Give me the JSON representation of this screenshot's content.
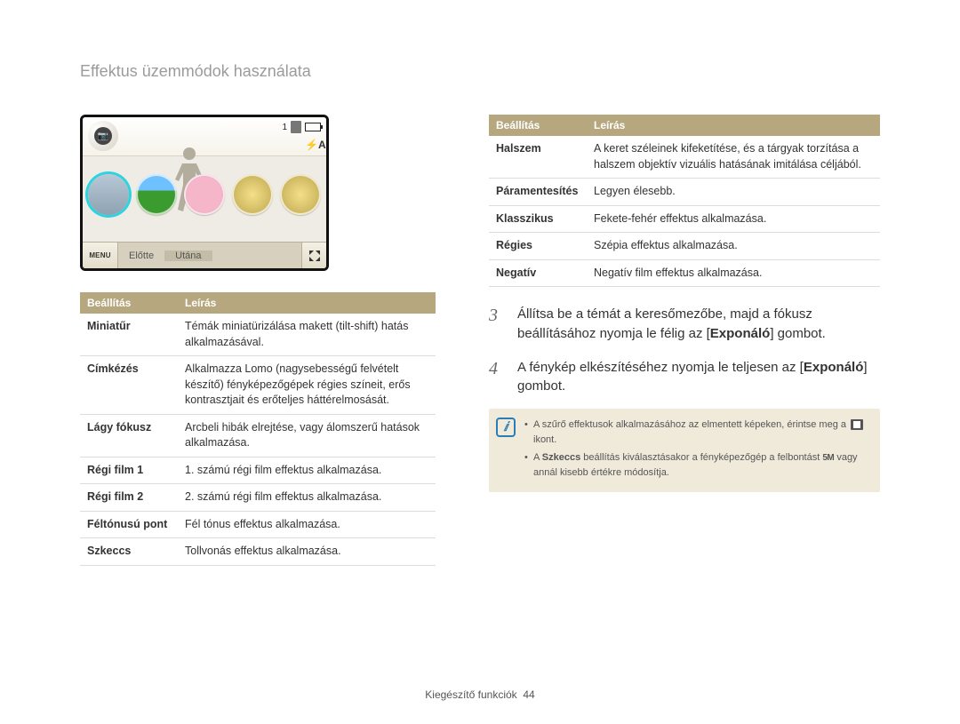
{
  "page_title": "Effektus üzemmódok használata",
  "lcd": {
    "status_number": "1",
    "flash": "⚡A",
    "menu_label": "MENU",
    "before_label": "Előtte",
    "after_label": "Utána"
  },
  "left_table": {
    "header_setting": "Beállítás",
    "header_desc": "Leírás",
    "rows": [
      {
        "name": "Miniatűr",
        "desc": "Témák miniatürizálása makett (tilt-shift) hatás alkalmazásával."
      },
      {
        "name": "Címkézés",
        "desc": "Alkalmazza Lomo (nagysebességű felvételt készítő) fényképezőgépek régies színeit, erős kontrasztjait és erőteljes háttérelmosását."
      },
      {
        "name": "Lágy fókusz",
        "desc": "Arcbeli hibák elrejtése, vagy álomszerű hatások alkalmazása."
      },
      {
        "name": "Régi film 1",
        "desc": "1. számú régi film effektus alkalmazása."
      },
      {
        "name": "Régi film 2",
        "desc": "2. számú régi film effektus alkalmazása."
      },
      {
        "name": "Féltónusú pont",
        "desc": "Fél tónus effektus alkalmazása."
      },
      {
        "name": "Szkeccs",
        "desc": "Tollvonás effektus alkalmazása."
      }
    ]
  },
  "right_table": {
    "header_setting": "Beállítás",
    "header_desc": "Leírás",
    "rows": [
      {
        "name": "Halszem",
        "desc": "A keret széleinek kifeketítése, és a tárgyak torzítása a halszem objektív vizuális hatásának imitálása céljából."
      },
      {
        "name": "Páramentesítés",
        "desc": "Legyen élesebb."
      },
      {
        "name": "Klasszikus",
        "desc": "Fekete-fehér effektus alkalmazása."
      },
      {
        "name": "Régies",
        "desc": "Szépia effektus alkalmazása."
      },
      {
        "name": "Negatív",
        "desc": "Negatív film effektus alkalmazása."
      }
    ]
  },
  "steps": {
    "s3": {
      "num": "3",
      "text_a": "Állítsa be a témát a keresőmezőbe, majd a fókusz beállításához nyomja le félig az [",
      "bold": "Exponáló",
      "text_b": "] gombot."
    },
    "s4": {
      "num": "4",
      "text_a": "A fénykép elkészítéséhez nyomja le teljesen az [",
      "bold": "Exponáló",
      "text_b": "] gombot."
    }
  },
  "note": {
    "line1_a": "A szűrő effektusok alkalmazásához az elmentett képeken, érintse meg a ",
    "line1_b": " ikont.",
    "line2_a": "A ",
    "line2_bold": "Szkeccs",
    "line2_b": " beállítás kiválasztásakor a fényképezőgép a felbontást ",
    "line2_sm": "5M",
    "line2_c": " vagy annál kisebb értékre módosítja."
  },
  "footer": {
    "label": "Kiegészítő funkciók",
    "page": "44"
  }
}
